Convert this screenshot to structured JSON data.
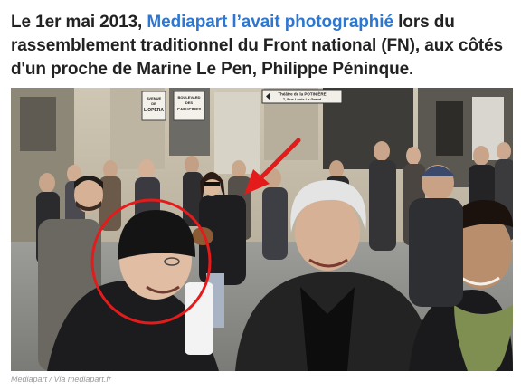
{
  "article": {
    "headline_part1": "Le 1er mai 2013, ",
    "headline_link": "Mediapart l’avait photographié",
    "headline_part2": " lors du rassemblement traditionnel du Front national (FN), aux côtés d'un proche de Marine Le Pen, Philippe Péninque."
  },
  "photo": {
    "signs": {
      "street1_line1": "AVENUE",
      "street1_line2": "DE",
      "street1_line3": "L'OPÉRA",
      "street2_line1": "BOULEVARD",
      "street2_line2": "DES",
      "street2_line3": "CAPUCINES",
      "theatre_line1": "Théâtre de la POTINIÈRE",
      "theatre_line2": "7, Rue Louis Le Grand"
    },
    "annotation_color": "#e41b1b"
  },
  "caption": "Mediapart / Via mediapart.fr"
}
